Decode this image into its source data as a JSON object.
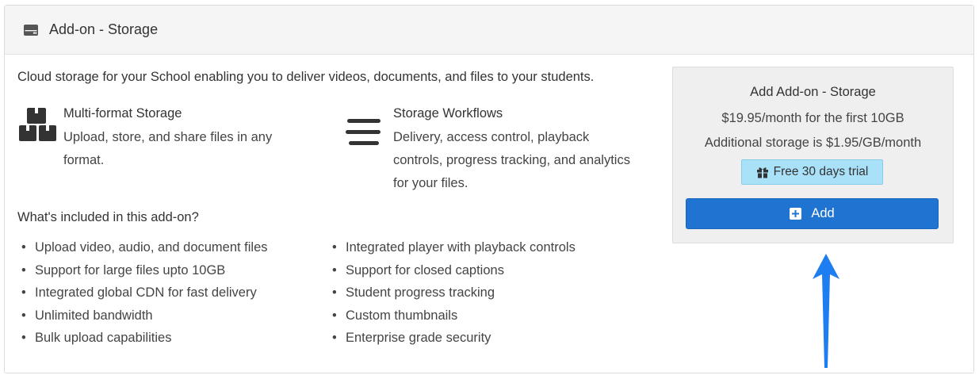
{
  "header": {
    "title": "Add-on - Storage",
    "icon": "hdd-icon"
  },
  "intro": "Cloud storage for your School enabling you to deliver videos, documents, and files to your students.",
  "features": [
    {
      "icon": "boxes-icon",
      "title": "Multi-format Storage",
      "desc": [
        "Upload, store, and share files in any",
        "format."
      ]
    },
    {
      "icon": "bars-icon",
      "title": "Storage Workflows",
      "desc": [
        "Delivery, access control, playback",
        "controls, progress tracking, and analytics",
        "for your files."
      ]
    }
  ],
  "included": {
    "title": "What's included in this add-on?",
    "col1": [
      "Upload video, audio, and document files",
      "Support for large files upto 10GB",
      "Integrated global CDN for fast delivery",
      "Unlimited bandwidth",
      "Bulk upload capabilities"
    ],
    "col2": [
      "Integrated player with playback controls",
      "Support for closed captions",
      "Student progress tracking",
      "Custom thumbnails",
      "Enterprise grade security"
    ]
  },
  "pricing": {
    "title": "Add Add-on - Storage",
    "line1": "$19.95/month for the first 10GB",
    "line2": "Additional storage is $1.95/GB/month",
    "trial_label": "Free 30 days trial",
    "add_label": "Add"
  },
  "colors": {
    "primary": "#1e74d0",
    "trial_bg": "#a8e1f8",
    "arrow": "#1f7df2"
  }
}
